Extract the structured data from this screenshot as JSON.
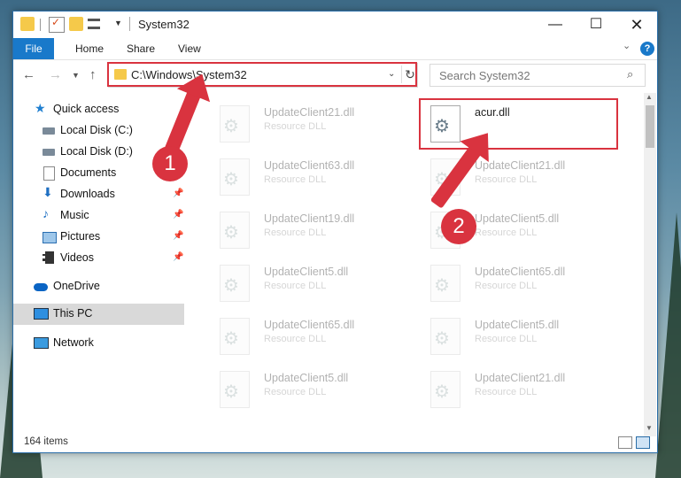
{
  "window": {
    "title": "System32"
  },
  "ribbon": {
    "file": "File",
    "home": "Home",
    "share": "Share",
    "view": "View",
    "help": "?"
  },
  "address": {
    "path": "C:\\Windows\\System32"
  },
  "search": {
    "placeholder": "Search System32"
  },
  "sidebar": {
    "items": [
      {
        "label": "Quick access"
      },
      {
        "label": "Local Disk (C:)"
      },
      {
        "label": "Local Disk (D:)"
      },
      {
        "label": "Documents"
      },
      {
        "label": "Downloads"
      },
      {
        "label": "Music"
      },
      {
        "label": "Pictures"
      },
      {
        "label": "Videos"
      },
      {
        "label": "OneDrive"
      },
      {
        "label": "This PC"
      },
      {
        "label": "Network"
      }
    ]
  },
  "files": [
    {
      "name": "UpdateClient21.dll",
      "type": "Resource DLL"
    },
    {
      "name": "acur.dll",
      "type": ""
    },
    {
      "name": "UpdateClient63.dll",
      "type": "Resource DLL"
    },
    {
      "name": "UpdateClient21.dll",
      "type": "Resource DLL"
    },
    {
      "name": "UpdateClient19.dll",
      "type": "Resource DLL"
    },
    {
      "name": "UpdateClient5.dll",
      "type": "Resource DLL"
    },
    {
      "name": "UpdateClient5.dll",
      "type": "Resource DLL"
    },
    {
      "name": "UpdateClient65.dll",
      "type": "Resource DLL"
    },
    {
      "name": "UpdateClient65.dll",
      "type": "Resource DLL"
    },
    {
      "name": "UpdateClient5.dll",
      "type": "Resource DLL"
    },
    {
      "name": "UpdateClient5.dll",
      "type": "Resource DLL"
    },
    {
      "name": "UpdateClient21.dll",
      "type": "Resource DLL"
    }
  ],
  "status": {
    "count": "164 items"
  },
  "annotations": {
    "step1": "1",
    "step2": "2",
    "accent": "#d9333f"
  }
}
